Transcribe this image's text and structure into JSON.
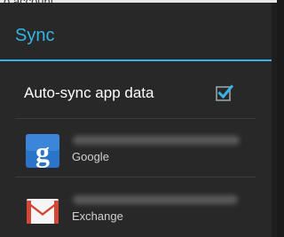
{
  "background": {
    "partial_text": "o account"
  },
  "dialog": {
    "title": "Sync",
    "accent_color": "#33b5e5",
    "auto_sync": {
      "label": "Auto-sync app data",
      "checked": true
    },
    "accounts": [
      {
        "type": "Google",
        "icon": "google-icon"
      },
      {
        "type": "Exchange",
        "icon": "gmail-icon"
      }
    ]
  }
}
